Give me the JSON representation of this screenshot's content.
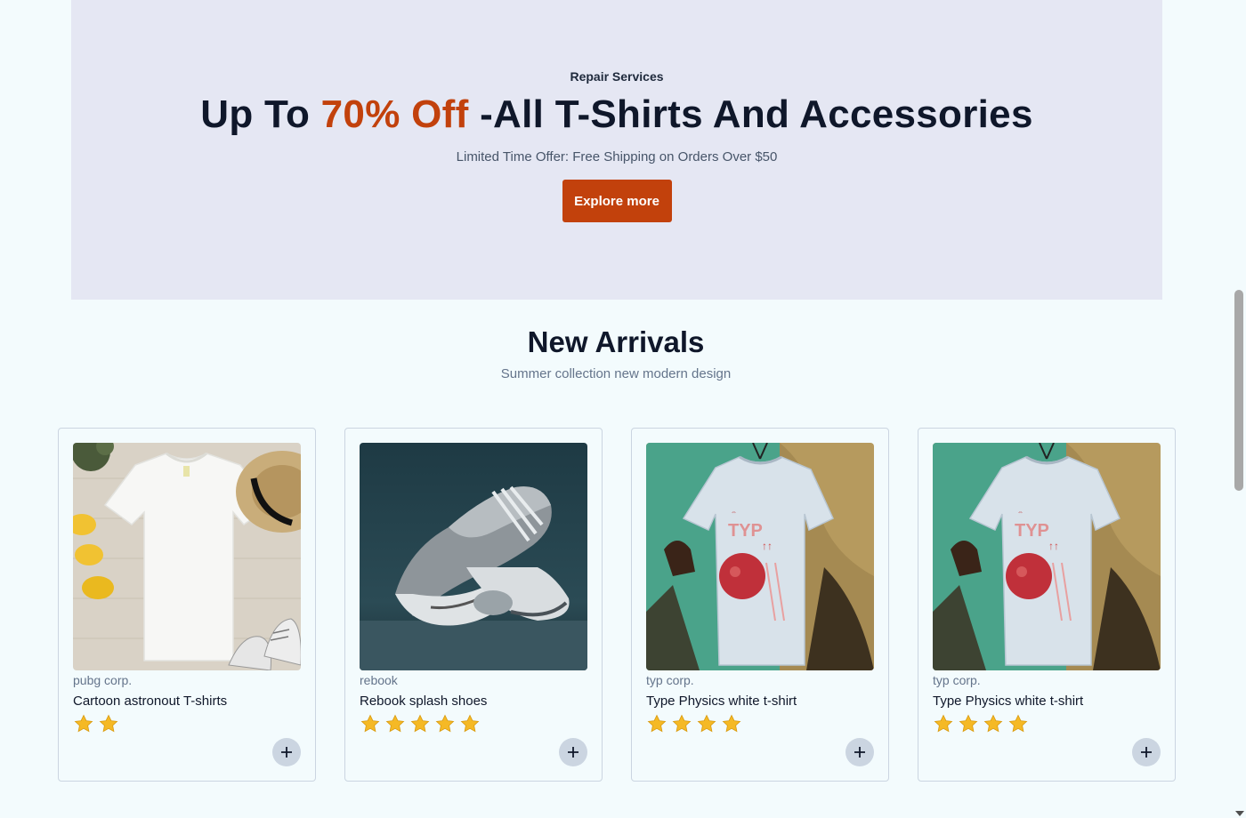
{
  "banner": {
    "eyebrow": "Repair Services",
    "headline_prefix": "Up To ",
    "headline_accent": "70% Off",
    "headline_suffix": " -All T-Shirts And Accessories",
    "subtitle": "Limited Time Offer: Free Shipping on Orders Over $50",
    "cta_label": "Explore more",
    "accent_color": "#c2410c",
    "background_color": "#e5e7f3"
  },
  "new_arrivals": {
    "title": "New Arrivals",
    "subtitle": "Summer collection new modern design"
  },
  "products": [
    {
      "brand": "pubg corp.",
      "title": "Cartoon astronout T-shirts",
      "rating": 2,
      "image": "white-tshirt-flatlay"
    },
    {
      "brand": "rebook",
      "title": "Rebook splash shoes",
      "rating": 5,
      "image": "grey-sneakers"
    },
    {
      "brand": "typ corp.",
      "title": "Type Physics white t-shirt",
      "rating": 4,
      "image": "hanging-printed-tshirt"
    },
    {
      "brand": "typ corp.",
      "title": "Type Physics white t-shirt",
      "rating": 4,
      "image": "hanging-printed-tshirt"
    }
  ],
  "icons": {
    "star": "star-icon",
    "add": "plus-icon"
  },
  "colors": {
    "star": "#f5b925",
    "add_button": "#cbd5e1"
  }
}
